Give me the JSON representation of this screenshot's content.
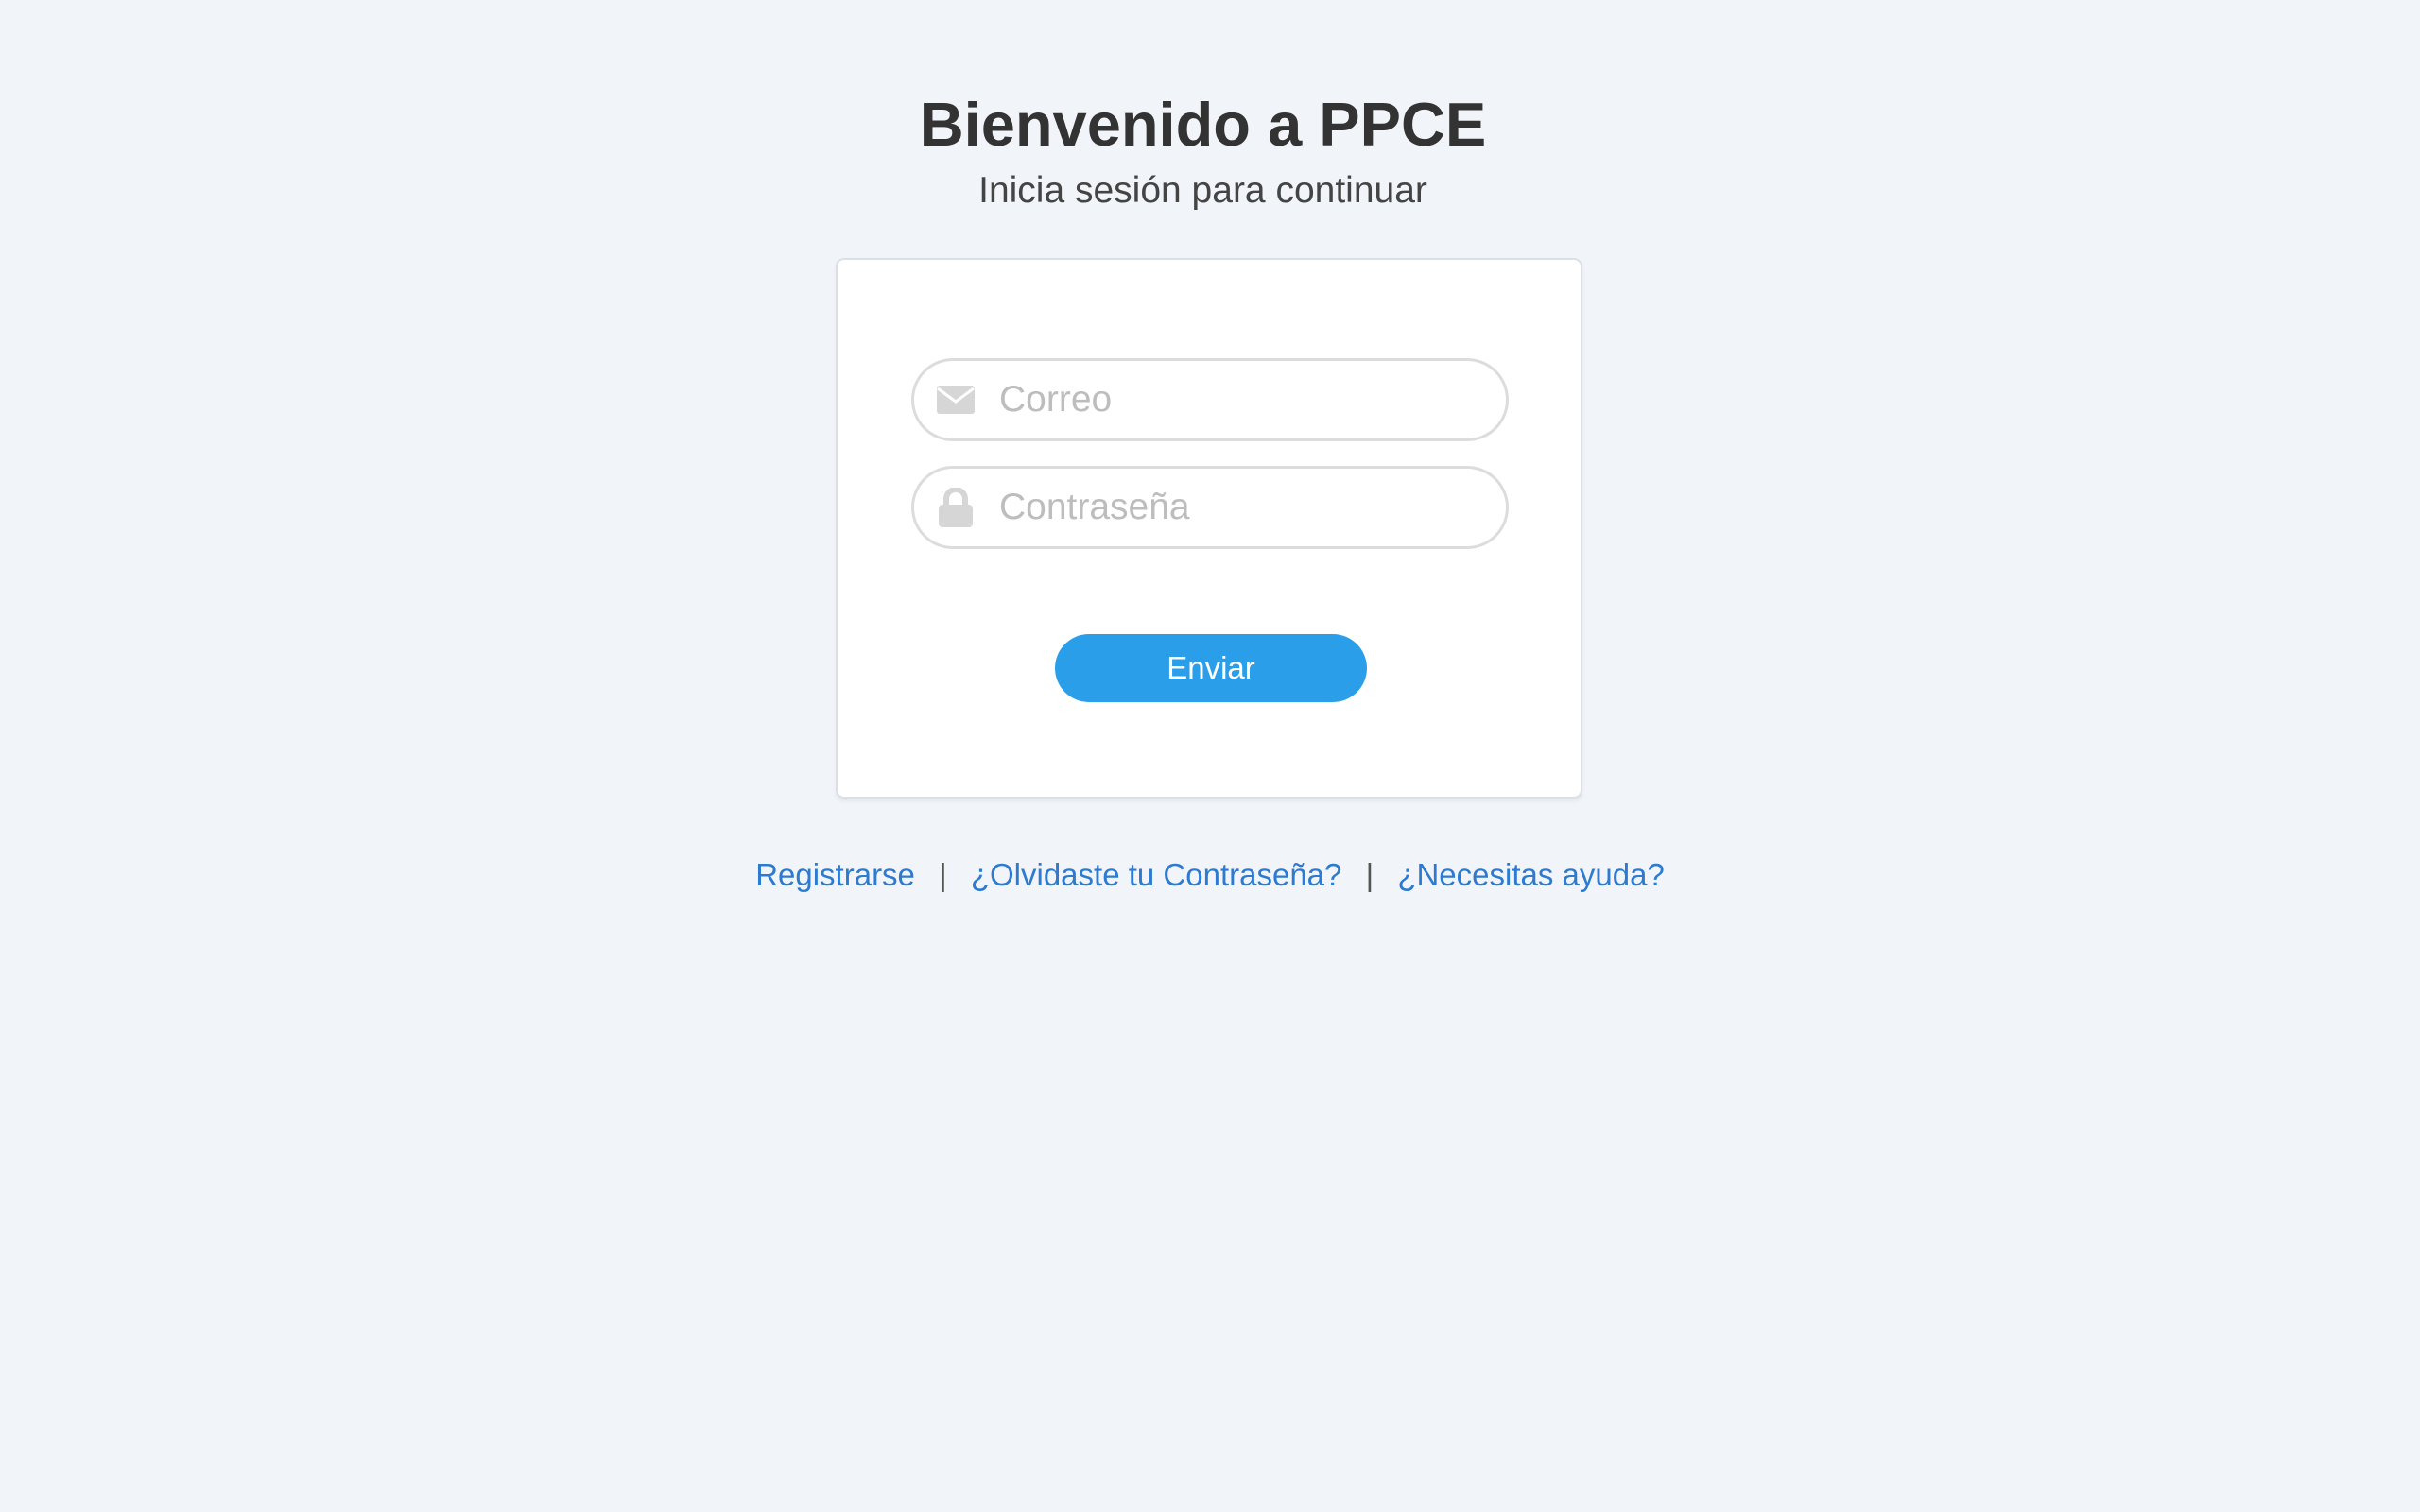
{
  "header": {
    "title": "Bienvenido a PPCE",
    "subtitle": "Inicia sesión para continuar"
  },
  "form": {
    "email": {
      "icon": "envelope-icon",
      "placeholder": "Correo",
      "value": ""
    },
    "password": {
      "icon": "lock-icon",
      "placeholder": "Contraseña",
      "value": ""
    },
    "submit_label": "Enviar"
  },
  "links": {
    "register": "Registrarse",
    "separator_1": "|",
    "forgot_password": "¿Olvidaste tu Contraseña?",
    "separator_2": "|",
    "help": "¿Necesitas ayuda?"
  },
  "colors": {
    "background": "#f1f5fa",
    "primary_button": "#2b9eea",
    "link": "#2d7bd0",
    "icon": "#d6d6d6",
    "placeholder": "#bdbdbd"
  }
}
